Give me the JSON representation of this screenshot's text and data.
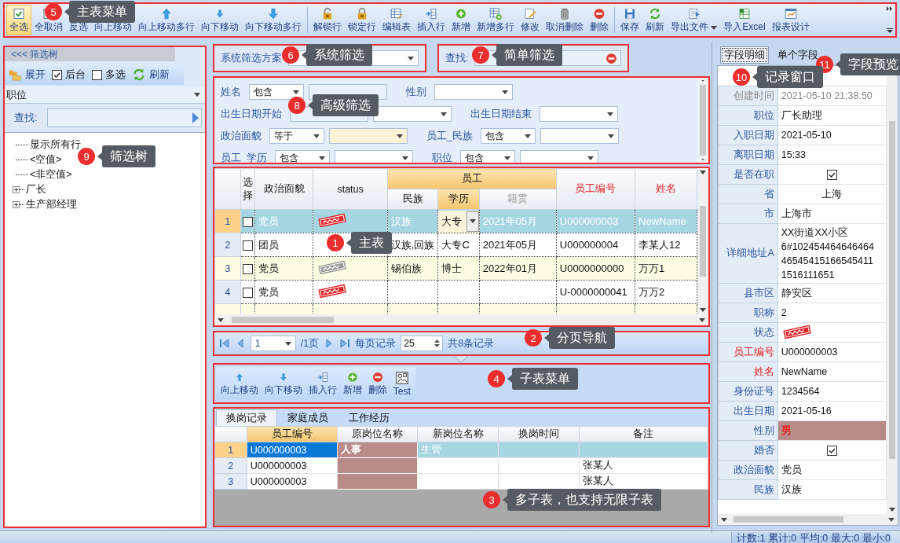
{
  "toolbar": {
    "groups": [
      {
        "items": [
          {
            "label": "全选",
            "kind": "check",
            "selected": true
          },
          {
            "label": "全取消",
            "kind": "clear",
            "selected": false
          },
          {
            "label": "反选",
            "kind": "invert",
            "selected": false
          },
          {
            "label": "向上移动",
            "kind": "up",
            "selected": false
          },
          {
            "label": "向上移动多行",
            "kind": "up2",
            "selected": false
          },
          {
            "label": "向下移动",
            "kind": "down",
            "selected": false
          },
          {
            "label": "向下移动多行",
            "kind": "down2",
            "selected": false
          }
        ]
      },
      {
        "items": [
          {
            "label": "解锁行",
            "kind": "unlock",
            "selected": false
          },
          {
            "label": "锁定行",
            "kind": "lock",
            "selected": false
          },
          {
            "label": "编辑表",
            "kind": "table-edit",
            "selected": false
          },
          {
            "label": "插入行",
            "kind": "insert",
            "selected": false
          },
          {
            "label": "新增",
            "kind": "add",
            "selected": false
          },
          {
            "label": "新增多行",
            "kind": "table-add",
            "selected": false
          },
          {
            "label": "修改",
            "kind": "edit",
            "selected": false
          },
          {
            "label": "取消删除",
            "kind": "undelete",
            "selected": false
          },
          {
            "label": "删除",
            "kind": "delete",
            "selected": false
          }
        ]
      },
      {
        "items": [
          {
            "label": "保存",
            "kind": "save",
            "selected": false
          },
          {
            "label": "刷新",
            "kind": "refresh",
            "selected": false
          },
          {
            "label": "导出文件",
            "kind": "export",
            "selected": false
          },
          {
            "label": "导入Excel",
            "kind": "excel",
            "selected": false
          },
          {
            "label": "报表设计",
            "kind": "report",
            "selected": false
          }
        ]
      }
    ]
  },
  "filter_tree": {
    "title": "<<< 筛选树",
    "tools": [
      {
        "label": "展开",
        "kind": "expand"
      },
      {
        "label": "后台",
        "kind": "checkbox",
        "checked": true
      },
      {
        "label": "多选",
        "kind": "checkbox",
        "checked": false
      },
      {
        "label": "刷新",
        "kind": "refresh"
      }
    ],
    "field": "职位",
    "find_label": "查找:",
    "nodes": [
      {
        "label": "显示所有行",
        "kind": "leaf"
      },
      {
        "label": "<空值>",
        "kind": "leaf"
      },
      {
        "label": "<非空值>",
        "kind": "leaf"
      },
      {
        "label": "厂长",
        "kind": "group",
        "expanded": false
      },
      {
        "label": "生产部经理",
        "kind": "group",
        "expanded": false
      }
    ]
  },
  "filter_bar": {
    "scheme_label": "系统筛选方案",
    "find_label": "查找:"
  },
  "advanced_filter": {
    "rows": [
      [
        {
          "label": "姓名",
          "kind": "op_text",
          "operator": "包含",
          "highlighted": false
        },
        {
          "label": "性别",
          "kind": "select",
          "highlighted": false
        }
      ],
      [
        {
          "label": "出生日期开始",
          "kind": "date",
          "highlighted": false
        },
        {
          "label": "出生日期结束",
          "kind": "select",
          "highlighted": false
        }
      ],
      [
        {
          "label": "政治面貌",
          "kind": "op_select",
          "operator": "等于",
          "highlighted": true
        },
        {
          "label": "员工_民族",
          "kind": "op_select",
          "operator": "包含",
          "highlighted": false
        }
      ],
      [
        {
          "label": "员工_学历",
          "kind": "op_select",
          "operator": "包含",
          "highlighted": false
        },
        {
          "label": "职位",
          "kind": "op_select",
          "operator": "包含",
          "highlighted": false
        }
      ]
    ]
  },
  "main_grid": {
    "columns": [
      {
        "label": "选择",
        "kind": "check",
        "key": false
      },
      {
        "label": "政治面貌",
        "kind": "text",
        "key": false
      },
      {
        "label": "status",
        "kind": "stamp",
        "key": false
      },
      {
        "label": "员工",
        "kind": "group",
        "colspan": 3,
        "children": [
          {
            "label": "民族",
            "selected": false,
            "disabled": false
          },
          {
            "label": "学历",
            "selected": true,
            "disabled": false
          },
          {
            "label": "籍贯",
            "selected": false,
            "disabled": true
          }
        ]
      },
      {
        "label": "员工编号",
        "kind": "text",
        "key": true
      },
      {
        "label": "姓名",
        "kind": "text",
        "key": true
      }
    ],
    "rows": [
      {
        "number": "1",
        "selected": true,
        "checked": false,
        "status": {
          "color": "#e5222a"
        },
        "cells": [
          "",
          "党员",
          "",
          "汉族",
          {
            "text": "大专",
            "editing": true
          },
          "2021年05月",
          "U000000003",
          "NewName"
        ]
      },
      {
        "number": "2",
        "selected": false,
        "checked": false,
        "cells": [
          "",
          "团员",
          "",
          "汉族,回族",
          "大专C",
          "2021年05月",
          "U000000004",
          "李某人12"
        ]
      },
      {
        "number": "3",
        "selected": false,
        "checked": false,
        "status": {
          "color": "#9a9a9a"
        },
        "cells": [
          "",
          "党员",
          "",
          "锡伯族",
          "博士",
          "2022年01月",
          "U0000000000",
          "万万1"
        ]
      },
      {
        "number": "4",
        "selected": false,
        "checked": false,
        "status": {
          "color": "#e5222a"
        },
        "cells": [
          "",
          "党员",
          "",
          "",
          "",
          "",
          "U-0000000041",
          "万万2"
        ]
      }
    ]
  },
  "pager": {
    "page": "1",
    "total_pages": "/1页",
    "per_page_label": "每页记录",
    "per_page": "25",
    "total": "共8条记录"
  },
  "sub_toolbar": {
    "items": [
      {
        "label": "向上移动",
        "kind": "up"
      },
      {
        "label": "向下移动",
        "kind": "down"
      },
      {
        "label": "插入行",
        "kind": "insert"
      },
      {
        "label": "新增",
        "kind": "add"
      },
      {
        "label": "删除",
        "kind": "delete"
      },
      {
        "label": "Test",
        "kind": "test"
      }
    ]
  },
  "sub_tabs": [
    {
      "label": "换岗记录",
      "selected": true
    },
    {
      "label": "家庭成员",
      "selected": false
    },
    {
      "label": "工作经历",
      "selected": false
    }
  ],
  "sub_grid": {
    "columns": [
      {
        "label": "员工编号",
        "selected": true,
        "marked": false
      },
      {
        "label": "原岗位名称",
        "selected": false,
        "marked": true
      },
      {
        "label": "新岗位名称",
        "selected": false,
        "marked": false
      },
      {
        "label": "换岗时间",
        "selected": false,
        "marked": false
      },
      {
        "label": "备注",
        "selected": false,
        "marked": false
      }
    ],
    "rows": [
      {
        "number": "1",
        "selected": true,
        "cells": [
          "U000000003",
          "人事",
          "生管",
          "",
          ""
        ]
      },
      {
        "number": "2",
        "selected": false,
        "cells": [
          "U000000003",
          "",
          "",
          "",
          "张某人"
        ]
      },
      {
        "number": "3",
        "selected": false,
        "cells": [
          "U000000003",
          "",
          "",
          "",
          "张某人"
        ]
      }
    ]
  },
  "record_panel": {
    "tabs": [
      {
        "label": "字段明细",
        "selected": true
      },
      {
        "label": "单个字段",
        "selected": false
      }
    ],
    "fields": [
      {
        "label": "创建时间",
        "value": "2021-05-10 21:38:50",
        "kind": "text",
        "disabled": true,
        "key": false,
        "marked": false
      },
      {
        "label": "职位",
        "value": "厂长助理",
        "kind": "text",
        "disabled": false,
        "key": false,
        "marked": false
      },
      {
        "label": "入职日期",
        "value": "2021-05-10",
        "kind": "text",
        "disabled": false,
        "key": false,
        "marked": false
      },
      {
        "label": "离职日期",
        "value": "15:33",
        "kind": "text",
        "disabled": false,
        "key": false,
        "marked": false
      },
      {
        "label": "是否在职",
        "kind": "check",
        "checked": true,
        "disabled": false,
        "key": false,
        "marked": false
      },
      {
        "label": "省",
        "value": "上海",
        "kind": "centered",
        "disabled": false,
        "key": false,
        "marked": false
      },
      {
        "label": "市",
        "value": "上海市",
        "kind": "text",
        "disabled": false,
        "key": false,
        "marked": false
      },
      {
        "label": "详细地址A",
        "value": "XX街道XX小区\n6#102454464646464\n46545415166545411\n1516111651",
        "kind": "text",
        "disabled": false,
        "key": false,
        "marked": false
      },
      {
        "label": "县市区",
        "value": "静安区",
        "kind": "text",
        "disabled": false,
        "key": false,
        "marked": false
      },
      {
        "label": "职称",
        "value": "2",
        "kind": "text",
        "disabled": false,
        "key": false,
        "marked": false
      },
      {
        "label": "状态",
        "kind": "stamp",
        "color": "#e5222a",
        "disabled": false,
        "key": false,
        "marked": false
      },
      {
        "label": "员工编号",
        "value": "U000000003",
        "kind": "text",
        "disabled": false,
        "key": true,
        "marked": false
      },
      {
        "label": "姓名",
        "value": "NewName",
        "kind": "text",
        "disabled": false,
        "key": true,
        "marked": false
      },
      {
        "label": "身份证号",
        "value": "1234564",
        "kind": "text",
        "disabled": false,
        "key": false,
        "marked": false
      },
      {
        "label": "出生日期",
        "value": "2021-05-16",
        "kind": "text",
        "disabled": false,
        "key": false,
        "marked": false
      },
      {
        "label": "性别",
        "value": "男",
        "kind": "text",
        "disabled": false,
        "key": false,
        "marked": true
      },
      {
        "label": "婚否",
        "kind": "check",
        "checked": true,
        "disabled": false,
        "key": false,
        "marked": false
      },
      {
        "label": "政治面貌",
        "value": "党员",
        "kind": "text",
        "disabled": false,
        "key": false,
        "marked": false
      },
      {
        "label": "民族",
        "value": "汉族",
        "kind": "text",
        "disabled": false,
        "key": false,
        "marked": false
      }
    ]
  },
  "status_bar": "计数:1 累计:0 平均:0 最大:0 最小:0",
  "callouts": [
    {
      "number": "5",
      "text": "主表菜单"
    },
    {
      "number": "6",
      "text": "系统筛选"
    },
    {
      "number": "7",
      "text": "简单筛选"
    },
    {
      "number": "11",
      "text": "字段预览"
    },
    {
      "number": "10",
      "text": "记录窗口"
    },
    {
      "number": "8",
      "text": "高级筛选"
    },
    {
      "number": "9",
      "text": "筛选树"
    },
    {
      "number": "1",
      "text": "主表"
    },
    {
      "number": "2",
      "text": "分页导航"
    },
    {
      "number": "4",
      "text": "子表菜单"
    },
    {
      "number": "3",
      "text": "多子表，也支持无限子表"
    }
  ]
}
